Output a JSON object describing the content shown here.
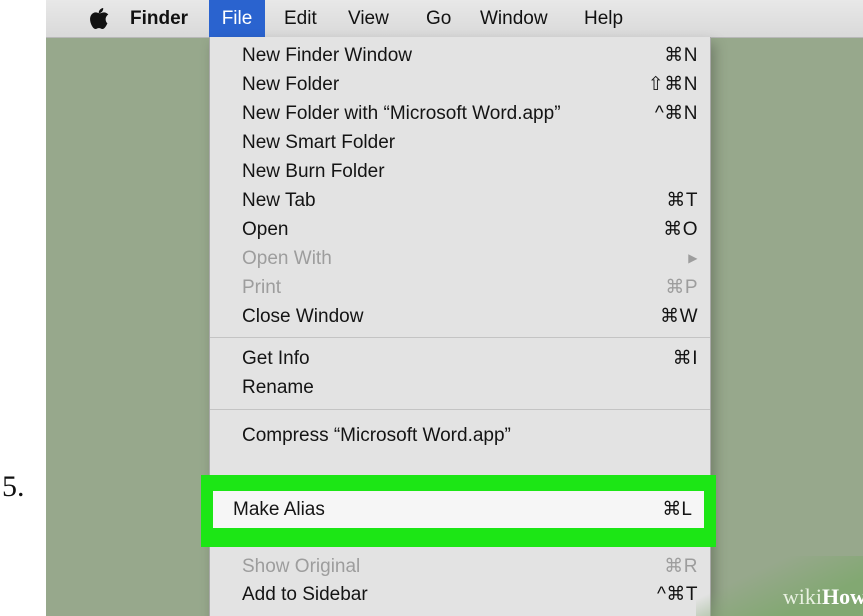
{
  "step": {
    "number": "5."
  },
  "menubar": {
    "apple_icon": "apple-logo",
    "items": [
      "Finder",
      "File",
      "Edit",
      "View",
      "Go",
      "Window",
      "Help"
    ],
    "active_item": "File"
  },
  "file_menu": {
    "groups": [
      [
        {
          "label": "New Finder Window",
          "shortcut": "⌘N",
          "enabled": true
        },
        {
          "label": "New Folder",
          "shortcut": "⇧⌘N",
          "enabled": true
        },
        {
          "label": "New Folder with “Microsoft Word.app”",
          "shortcut": "^⌘N",
          "enabled": true
        },
        {
          "label": "New Smart Folder",
          "shortcut": "",
          "enabled": true
        },
        {
          "label": "New Burn Folder",
          "shortcut": "",
          "enabled": true
        },
        {
          "label": "New Tab",
          "shortcut": "⌘T",
          "enabled": true
        },
        {
          "label": "Open",
          "shortcut": "⌘O",
          "enabled": true
        },
        {
          "label": "Open With",
          "shortcut": "▶",
          "enabled": false
        },
        {
          "label": "Print",
          "shortcut": "⌘P",
          "enabled": false
        },
        {
          "label": "Close Window",
          "shortcut": "⌘W",
          "enabled": true
        }
      ],
      [
        {
          "label": "Get Info",
          "shortcut": "⌘I",
          "enabled": true
        },
        {
          "label": "Rename",
          "shortcut": "",
          "enabled": true
        }
      ],
      [
        {
          "label": "Compress “Microsoft Word.app”",
          "shortcut": "",
          "enabled": true
        }
      ]
    ],
    "bottom_items": [
      {
        "label": "Show Original",
        "shortcut": "⌘R",
        "enabled": false
      },
      {
        "label": "Add to Sidebar",
        "shortcut": "^⌘T",
        "enabled": true
      }
    ],
    "highlighted_item": {
      "label": "Make Alias",
      "shortcut": "⌘L"
    }
  },
  "watermark": {
    "prefix": "wiki",
    "suffix": "How"
  },
  "colors": {
    "highlight": "#1ce615",
    "menu_active": "#2a63cf",
    "background": "#97a88c"
  }
}
